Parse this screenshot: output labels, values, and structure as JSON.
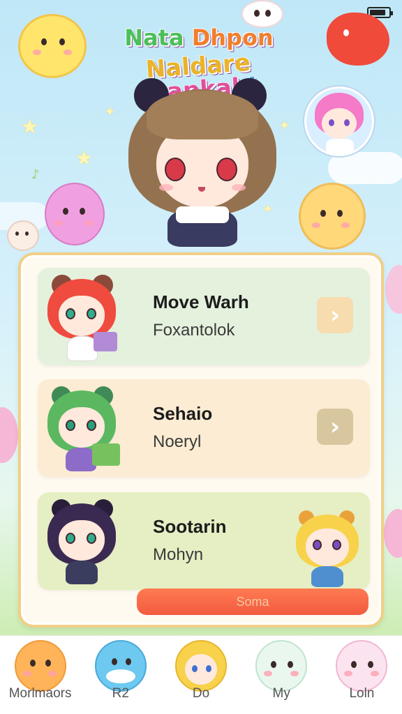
{
  "status_bar": {
    "battery_level": 0.85
  },
  "header": {
    "title_line1": [
      "Nata ",
      "Dhpon"
    ],
    "title_line2": [
      "Naldare ",
      "Inapkak",
      "!"
    ]
  },
  "list": {
    "items": [
      {
        "name": "Move Warh",
        "subtitle": "Foxantolok",
        "card_color": "#e4f1dd",
        "button_color": "#f6dcae",
        "avatar": "red-hair-girl-avatar"
      },
      {
        "name": "Sehaio",
        "subtitle": "Noeryl",
        "card_color": "#fbecd3",
        "button_color": "#d8c79e",
        "avatar": "green-hair-girl-avatar"
      },
      {
        "name": "Sootarin",
        "subtitle": "Mohyn",
        "card_color": "#e5efc3",
        "avatar": "dark-hair-girl-avatar"
      }
    ],
    "action_button_label": "Soma"
  },
  "bottom_nav": {
    "items": [
      {
        "label": "Morlmaors",
        "icon": "orange-hamster-icon"
      },
      {
        "label": "R2",
        "icon": "blue-whale-icon"
      },
      {
        "label": "Do",
        "icon": "blonde-girl-icon"
      },
      {
        "label": "My",
        "icon": "mint-cat-icon"
      },
      {
        "label": "Loln",
        "icon": "pink-bunny-icon"
      }
    ]
  },
  "colors": {
    "panel_border": "#f1cf85",
    "accent": "#f25a3f"
  }
}
